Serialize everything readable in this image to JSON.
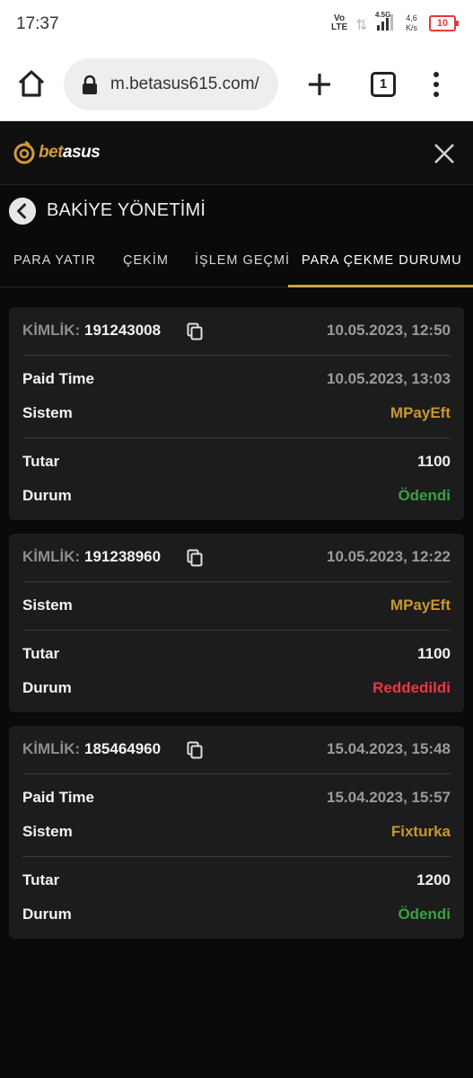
{
  "status_bar": {
    "time": "17:37",
    "network_top": "Vo",
    "network_bottom": "LTE",
    "signal_type": "4.5G",
    "speed_top": "4,6",
    "speed_bottom": "K/s",
    "battery": "10"
  },
  "browser": {
    "url": "m.betasus615.com/",
    "tab_count": "1"
  },
  "site": {
    "logo_part1": "bet",
    "logo_part2": "asus"
  },
  "page": {
    "title": "BAKİYE YÖNETİMİ",
    "tabs": [
      {
        "label": "PARA YATIR"
      },
      {
        "label": "ÇEKİM"
      },
      {
        "label": "İŞLEM GEÇMİ"
      },
      {
        "label": "PARA ÇEKME DURUMU"
      }
    ]
  },
  "labels": {
    "kimlik": "KİMLİK:",
    "paid_time": "Paid Time",
    "sistem": "Sistem",
    "tutar": "Tutar",
    "durum": "Durum"
  },
  "withdrawals": [
    {
      "id": "191243008",
      "date": "10.05.2023, 12:50",
      "paid_time": "10.05.2023, 13:03",
      "system": "MPayEft",
      "amount": "1100",
      "status": "Ödendi"
    },
    {
      "id": "191238960",
      "date": "10.05.2023, 12:22",
      "system": "MPayEft",
      "amount": "1100",
      "status": "Reddedildi"
    },
    {
      "id": "185464960",
      "date": "15.04.2023, 15:48",
      "paid_time": "15.04.2023, 15:57",
      "system": "Fixturka",
      "amount": "1200",
      "status": "Ödendi"
    }
  ],
  "colors": {
    "accent": "#c9a24a",
    "system_text": "#c9962e",
    "status_paid": "#3aa040",
    "status_rejected": "#ee3344",
    "card_bg": "#1c1c1c",
    "page_bg": "#0a0a0a"
  },
  "icons": {
    "home": "home-icon",
    "lock": "lock-icon",
    "plus": "plus-icon",
    "menu": "more-vertical-icon",
    "close": "close-icon",
    "back": "chevron-left-icon",
    "copy": "copy-icon"
  }
}
